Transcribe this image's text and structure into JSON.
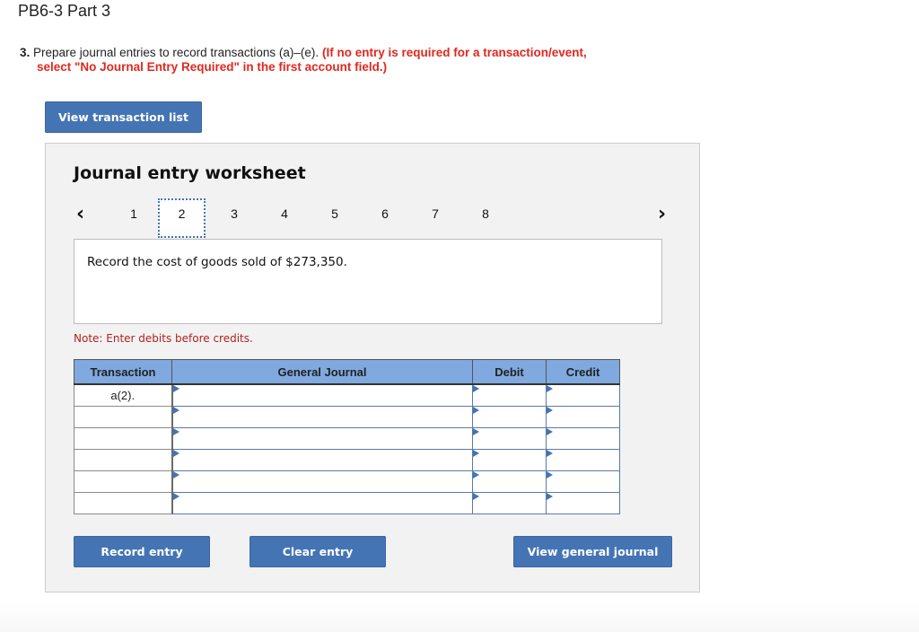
{
  "page": {
    "title": "PB6-3 Part 3"
  },
  "instructions": {
    "number": "3.",
    "text": "Prepare journal entries to record transactions (a)–(e).",
    "warning_line1": "(If no entry is required for a transaction/event,",
    "warning_line2": "select \"No Journal Entry Required\" in the first account field.)"
  },
  "buttons": {
    "view_transaction_list": "View transaction list",
    "record_entry": "Record entry",
    "clear_entry": "Clear entry",
    "view_general_journal": "View general journal"
  },
  "worksheet": {
    "title": "Journal entry worksheet",
    "prev_icon": "chevron-left-icon",
    "next_icon": "chevron-right-icon",
    "tabs": [
      "1",
      "2",
      "3",
      "4",
      "5",
      "6",
      "7",
      "8"
    ],
    "active_tab": "2",
    "description": "Record the cost of goods sold of $273,350.",
    "note": "Note: Enter debits before credits."
  },
  "journal_table": {
    "headers": [
      "Transaction",
      "General Journal",
      "Debit",
      "Credit"
    ],
    "rows": [
      {
        "transaction": "a(2).",
        "account": "",
        "debit": "",
        "credit": ""
      },
      {
        "transaction": "",
        "account": "",
        "debit": "",
        "credit": ""
      },
      {
        "transaction": "",
        "account": "",
        "debit": "",
        "credit": ""
      },
      {
        "transaction": "",
        "account": "",
        "debit": "",
        "credit": ""
      },
      {
        "transaction": "",
        "account": "",
        "debit": "",
        "credit": ""
      },
      {
        "transaction": "",
        "account": "",
        "debit": "",
        "credit": ""
      }
    ]
  },
  "colors": {
    "button_blue": "#4474b3",
    "header_blue": "#7fa9df",
    "warning_red": "#e0281e",
    "note_red": "#b22222"
  }
}
